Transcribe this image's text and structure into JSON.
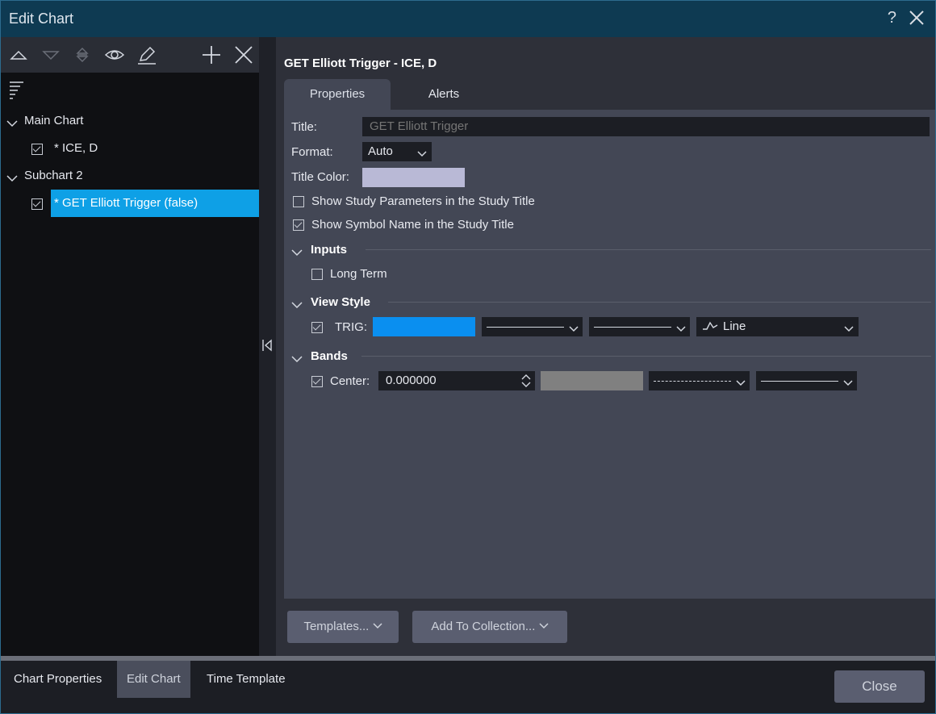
{
  "window": {
    "title": "Edit Chart",
    "help": "?"
  },
  "tree": {
    "main_chart": "Main Chart",
    "main_item": "* ICE, D",
    "subchart": "Subchart 2",
    "sub_item": "* GET Elliott Trigger (false)"
  },
  "study": {
    "heading": "GET Elliott Trigger - ICE, D",
    "tabs": [
      "Properties",
      "Alerts"
    ],
    "title_label": "Title:",
    "title_placeholder": "GET Elliott Trigger",
    "format_label": "Format:",
    "format_value": "Auto",
    "title_color_label": "Title Color:",
    "title_color": "#b9b9d6",
    "show_params": "Show Study Parameters in the Study Title",
    "show_params_checked": false,
    "show_symbol": "Show Symbol Name in the Study Title",
    "show_symbol_checked": true,
    "inputs": {
      "header": "Inputs",
      "long_term": "Long Term",
      "long_term_checked": false
    },
    "view_style": {
      "header": "View Style",
      "trig_label": "TRIG:",
      "trig_color": "#0a8ff0",
      "line_label": "Line"
    },
    "bands": {
      "header": "Bands",
      "center_label": "Center:",
      "center_value": "0.000000",
      "center_color": "#808080"
    }
  },
  "buttons": {
    "templates": "Templates...",
    "add_to_collection": "Add To Collection..."
  },
  "bottom": {
    "tabs": [
      "Chart Properties",
      "Edit Chart",
      "Time Template"
    ],
    "close": "Close"
  }
}
